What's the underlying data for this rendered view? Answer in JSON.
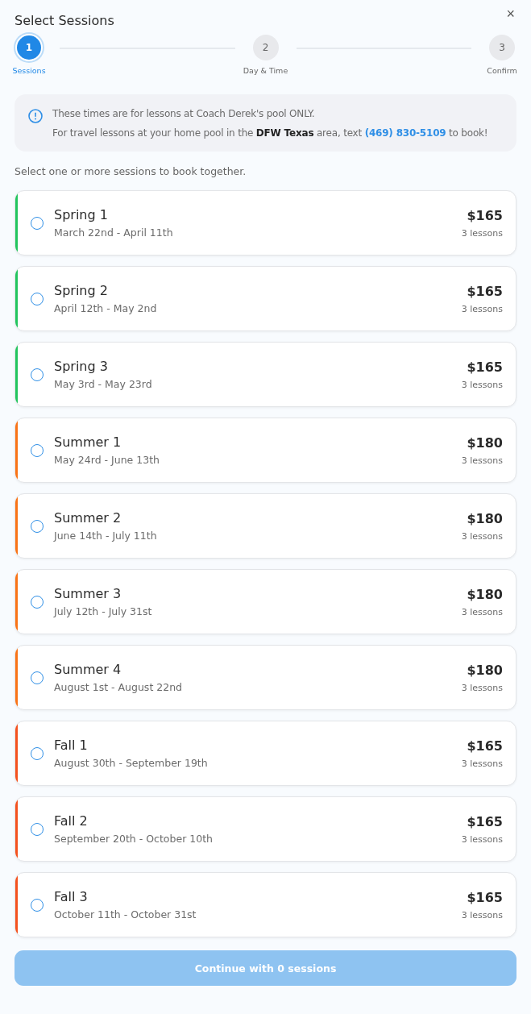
{
  "dialog": {
    "title": "Select Sessions",
    "close": "×"
  },
  "steps": [
    {
      "number": "1",
      "label": "Sessions",
      "selected": true
    },
    {
      "number": "2",
      "label": "Day & Time",
      "selected": false
    },
    {
      "number": "3",
      "label": "Confirm",
      "selected": false
    }
  ],
  "notice": {
    "line1": "These times are for lessons at Coach Derek's pool ONLY.",
    "line2_before": "For travel lessons at your home pool in the **DFW Texas** area, text",
    "link": "(469) 830-5109",
    "line2_after": "to book!"
  },
  "hint": "Select one or more sessions to book together.",
  "sessions": [
    {
      "name": "Spring 1",
      "dates": "March 22nd - April 11th",
      "price": "$165",
      "lessons": "3 lessons",
      "color": "#22c55e",
      "selected": false
    },
    {
      "name": "Spring 2",
      "dates": "April 12th - May 2nd",
      "price": "$165",
      "lessons": "3 lessons",
      "color": "#22c55e",
      "selected": false
    },
    {
      "name": "Spring 3",
      "dates": "May 3rd - May 23rd",
      "price": "$165",
      "lessons": "3 lessons",
      "color": "#22c55e",
      "selected": false
    },
    {
      "name": "Summer 1",
      "dates": "May 24rd - June 13th",
      "price": "$180",
      "lessons": "3 lessons",
      "color": "#f97316",
      "selected": false
    },
    {
      "name": "Summer 2",
      "dates": "June 14th - July 11th",
      "price": "$180",
      "lessons": "3 lessons",
      "color": "#f97316",
      "selected": false
    },
    {
      "name": "Summer 3",
      "dates": "July 12th - July 31st",
      "price": "$180",
      "lessons": "3 lessons",
      "color": "#f97316",
      "selected": false
    },
    {
      "name": "Summer 4",
      "dates": "August 1st - August 22nd",
      "price": "$180",
      "lessons": "3 lessons",
      "color": "#f97316",
      "selected": false
    },
    {
      "name": "Fall 1",
      "dates": "August 30th - September 19th",
      "price": "$165",
      "lessons": "3 lessons",
      "color": "#f4511e",
      "selected": false
    },
    {
      "name": "Fall 2",
      "dates": "September 20th - October 10th",
      "price": "$165",
      "lessons": "3 lessons",
      "color": "#f4511e",
      "selected": false
    },
    {
      "name": "Fall 3",
      "dates": "October 11th - October 31st",
      "price": "$165",
      "lessons": "3 lessons",
      "color": "#f4511e",
      "selected": false
    }
  ],
  "continue_button": {
    "label": "Continue with 0 sessions",
    "disabled": true
  }
}
